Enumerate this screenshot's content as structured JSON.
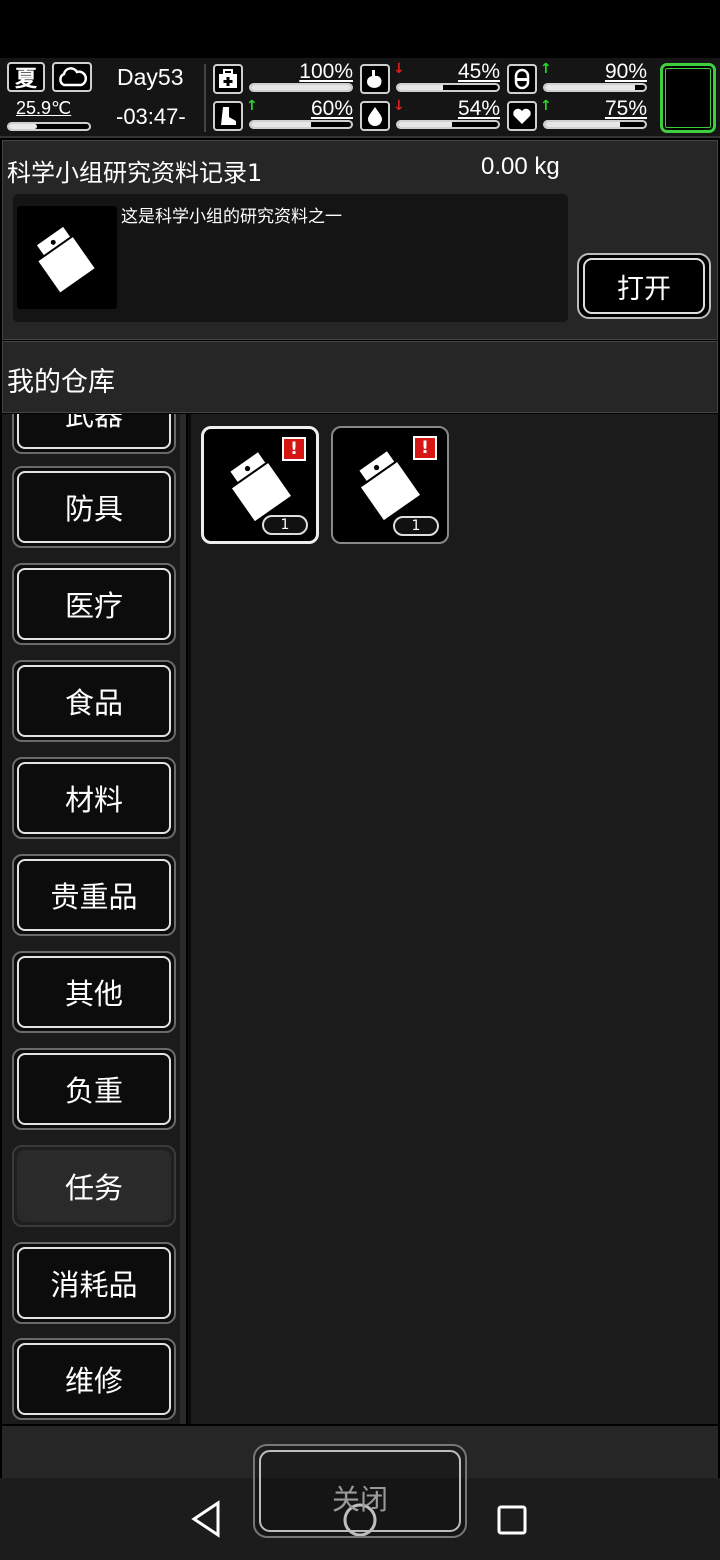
{
  "hud": {
    "season": "夏",
    "weather_icon": "cloud-icon",
    "temperature": "25.9℃",
    "temperature_level": 0.35,
    "day": "Day53",
    "clock": "-03:47-",
    "stats": [
      {
        "icon": "medkit-icon",
        "label": "health",
        "value": "100%",
        "level": 1.0,
        "arrow": "",
        "arrow_color": ""
      },
      {
        "icon": "stomach-icon",
        "label": "hunger",
        "value": "45%",
        "level": 0.45,
        "arrow": "down",
        "arrow_color": "#e02020"
      },
      {
        "icon": "pill-icon",
        "label": "mental",
        "value": "90%",
        "level": 0.9,
        "arrow": "up",
        "arrow_color": "#22dd22"
      },
      {
        "icon": "stamina-icon",
        "label": "stamina",
        "value": "60%",
        "level": 0.6,
        "arrow": "up",
        "arrow_color": "#22dd22"
      },
      {
        "icon": "water-drop-icon",
        "label": "thirst",
        "value": "54%",
        "level": 0.54,
        "arrow": "down",
        "arrow_color": "#e02020"
      },
      {
        "icon": "heart-icon",
        "label": "mood",
        "value": "75%",
        "level": 0.75,
        "arrow": "up",
        "arrow_color": "#22dd22"
      }
    ],
    "accent_color": "#3ecf3e"
  },
  "detail": {
    "name": "科学小组研究资料记录1",
    "weight": "0.00 kg",
    "description": "这是科学小组的研究资料之一",
    "icon": "document-icon",
    "open_label": "打开"
  },
  "warehouse": {
    "title": "我的仓库",
    "partial_category": "武器",
    "categories": [
      {
        "label": "防具",
        "active": false
      },
      {
        "label": "医疗",
        "active": false
      },
      {
        "label": "食品",
        "active": false
      },
      {
        "label": "材料",
        "active": false
      },
      {
        "label": "贵重品",
        "active": false
      },
      {
        "label": "其他",
        "active": false
      },
      {
        "label": "负重",
        "active": false
      },
      {
        "label": "任务",
        "active": true
      },
      {
        "label": "消耗品",
        "active": false
      },
      {
        "label": "维修",
        "active": false
      }
    ],
    "items": [
      {
        "icon": "document-icon",
        "count": "1",
        "new_mark": "!",
        "selected": true
      },
      {
        "icon": "document-icon",
        "count": "1",
        "new_mark": "!",
        "selected": false
      }
    ]
  },
  "footer": {
    "close_label": "关闭"
  },
  "navbar": {
    "back": "back-triangle-icon",
    "home": "home-circle-icon",
    "recents": "recents-square-icon"
  }
}
